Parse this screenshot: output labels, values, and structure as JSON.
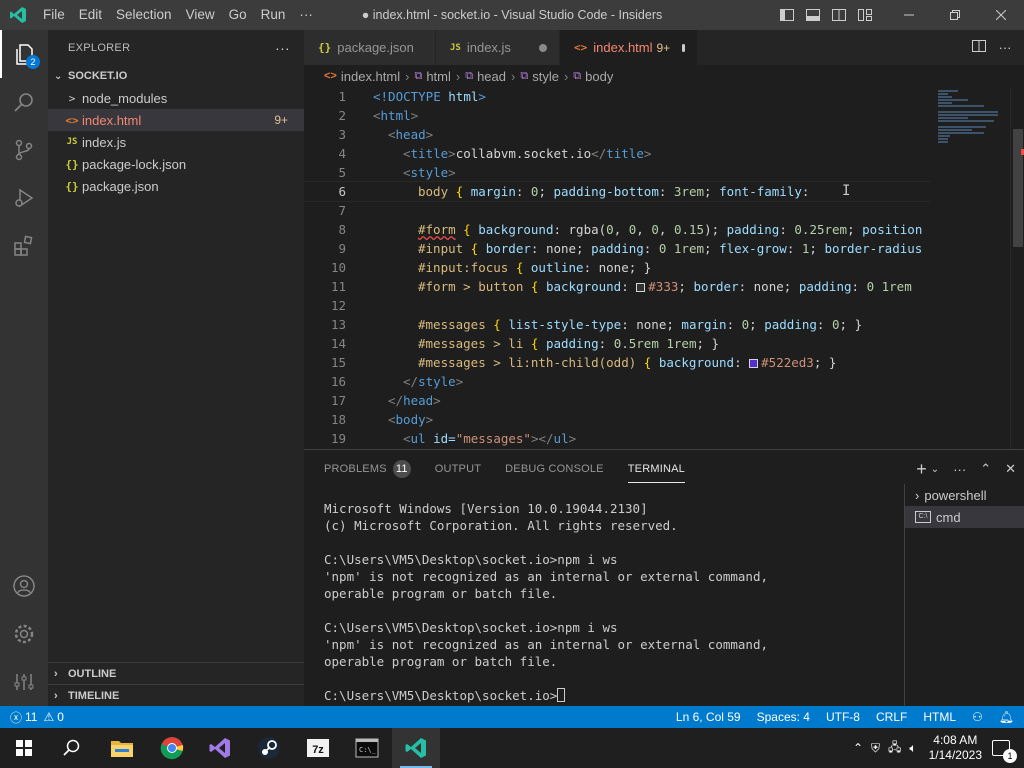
{
  "window": {
    "title": "● index.html - socket.io - Visual Studio Code - Insiders",
    "menu": [
      "File",
      "Edit",
      "Selection",
      "View",
      "Go",
      "Run",
      "···"
    ]
  },
  "activity_bar": {
    "explorer_badge": "2"
  },
  "sidebar": {
    "header": "EXPLORER",
    "more": "···",
    "folder": "SOCKET.IO",
    "items": [
      {
        "label": "node_modules",
        "icon": ">",
        "badge": ""
      },
      {
        "label": "index.html",
        "icon": "<>",
        "badge": "9+"
      },
      {
        "label": "index.js",
        "icon": "JS",
        "badge": ""
      },
      {
        "label": "package-lock.json",
        "icon": "{}",
        "badge": ""
      },
      {
        "label": "package.json",
        "icon": "{}",
        "badge": ""
      }
    ],
    "outline": "OUTLINE",
    "timeline": "TIMELINE"
  },
  "tabs": [
    {
      "label": "package.json",
      "icon": "{}"
    },
    {
      "label": "index.js",
      "icon": "JS"
    },
    {
      "label": "index.html",
      "icon": "<>",
      "badge": "9+"
    }
  ],
  "breadcrumbs": [
    "index.html",
    "html",
    "head",
    "style",
    "body"
  ],
  "code": {
    "line_numbers": [
      "1",
      "2",
      "3",
      "4",
      "5",
      "6",
      "7",
      "8",
      "9",
      "10",
      "11",
      "12",
      "13",
      "14",
      "15",
      "16",
      "17",
      "18",
      "19"
    ],
    "l1": [
      "<!DOCTYPE ",
      "html",
      ">"
    ],
    "l2": [
      "<",
      "html",
      ">"
    ],
    "l3": [
      "<",
      "head",
      ">"
    ],
    "l4": [
      "<",
      "title",
      ">",
      "collabvm.socket.io",
      "</",
      "title",
      ">"
    ],
    "l5": [
      "<",
      "style",
      ">"
    ],
    "l6": [
      "body",
      " { ",
      "margin",
      ": ",
      "0",
      "; ",
      "padding-bottom",
      ": ",
      "3rem",
      "; ",
      "font-family",
      ":"
    ],
    "l8": [
      "#form",
      " { ",
      "background",
      ": rgba(",
      "0",
      ", ",
      "0",
      ", ",
      "0",
      ", ",
      "0.15",
      "); ",
      "padding",
      ": ",
      "0.25rem",
      "; ",
      "position"
    ],
    "l9": [
      "#input",
      " { ",
      "border",
      ": none; ",
      "padding",
      ": ",
      "0 1rem",
      "; ",
      "flex-grow",
      ": ",
      "1",
      "; ",
      "border-radius"
    ],
    "l10": [
      "#input:focus",
      " { ",
      "outline",
      ": none; }"
    ],
    "l11": [
      "#form > button",
      " { ",
      "background",
      ": ",
      "#333",
      "; ",
      "border",
      ": none; ",
      "padding",
      ": ",
      "0 1rem"
    ],
    "l13": [
      "#messages",
      " { ",
      "list-style-type",
      ": none; ",
      "margin",
      ": ",
      "0",
      "; ",
      "padding",
      ": ",
      "0",
      "; }"
    ],
    "l14": [
      "#messages > li",
      " { ",
      "padding",
      ": ",
      "0.5rem 1rem",
      "; }"
    ],
    "l15": [
      "#messages > li:nth-child(odd)",
      " { ",
      "background",
      ": ",
      "#522ed3",
      "; }"
    ],
    "l16": [
      "</",
      "style",
      ">"
    ],
    "l17": [
      "</",
      "head",
      ">"
    ],
    "l18": [
      "<",
      "body",
      ">"
    ],
    "l19": [
      "<",
      "ul",
      " id=",
      "\"messages\"",
      "></",
      "ul",
      ">"
    ],
    "swatch_333": "#333333",
    "swatch_522ed3": "#522ed3"
  },
  "panel": {
    "tabs": [
      "PROBLEMS",
      "OUTPUT",
      "DEBUG CONSOLE",
      "TERMINAL"
    ],
    "problems_count": "11",
    "terminal_lines": [
      "Microsoft Windows [Version 10.0.19044.2130]",
      "(c) Microsoft Corporation. All rights reserved.",
      "",
      "C:\\Users\\VM5\\Desktop\\socket.io>npm i ws",
      "'npm' is not recognized as an internal or external command,",
      "operable program or batch file.",
      "",
      "C:\\Users\\VM5\\Desktop\\socket.io>npm i ws",
      "'npm' is not recognized as an internal or external command,",
      "operable program or batch file.",
      "",
      "C:\\Users\\VM5\\Desktop\\socket.io>"
    ],
    "terminals": [
      "powershell",
      "cmd"
    ]
  },
  "statusbar": {
    "errors": "11",
    "warnings": "0",
    "position": "Ln 6, Col 59",
    "spaces": "Spaces: 4",
    "encoding": "UTF-8",
    "eol": "CRLF",
    "language": "HTML"
  },
  "taskbar": {
    "time": "4:08 AM",
    "date": "1/14/2023",
    "notifications": "1",
    "apps": [
      "file-explorer",
      "chrome",
      "visual-studio",
      "steam",
      "7zip",
      "command-prompt",
      "vscode-insiders"
    ]
  },
  "colors": {
    "accent": "#007acc",
    "vscode_insiders": "#24bfa5"
  }
}
